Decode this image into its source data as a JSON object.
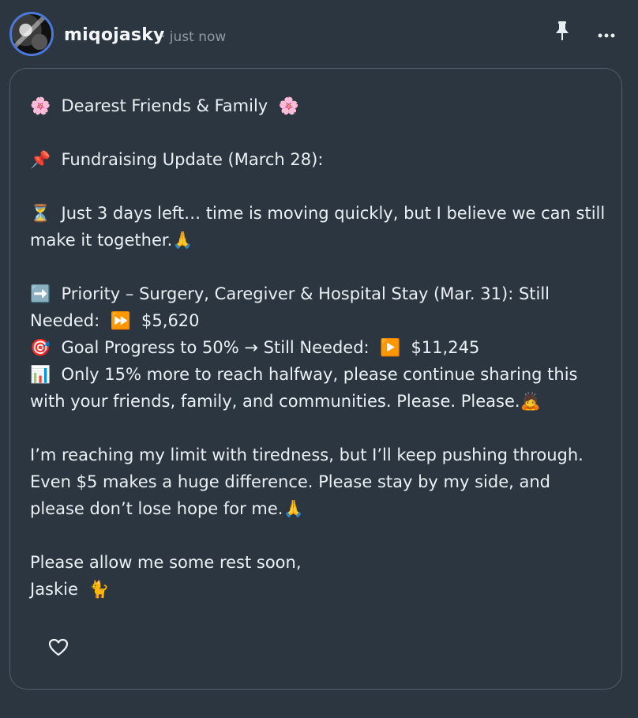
{
  "post": {
    "author": "miqojasky",
    "time": "· just now",
    "lines": [
      "🌸  Dearest Friends & Family  🌸",
      "📌  Fundraising Update (March 28):",
      "⏳  Just 3 days left… time is moving quickly, but I believe we can still make it together.🙏",
      "➡️  Priority – Surgery, Caregiver & Hospital Stay (Mar. 31): Still Needed:  ⏩  $5,620",
      "🎯  Goal Progress to 50% → Still Needed:  ▶️  $11,245",
      "📊  Only 15% more to reach halfway, please continue sharing this with your friends, family, and communities. Please. Please.🙇",
      "I’m reaching my limit with tiredness, but I’ll keep pushing through. Even $5 makes a huge difference. Please stay by my side, and please don’t lose hope for me.🙏",
      "Please allow me some rest soon,",
      "Jaskie  🐈"
    ]
  },
  "icons": {
    "avatar": "profile-avatar",
    "pin": "pin-icon",
    "more": "more-horizontal-icon",
    "like": "heart-outline-icon"
  },
  "colors": {
    "background": "#2b3640",
    "card_border": "#51606b",
    "avatar_ring": "#4c78d8",
    "muted_text": "#8f9aa3"
  }
}
